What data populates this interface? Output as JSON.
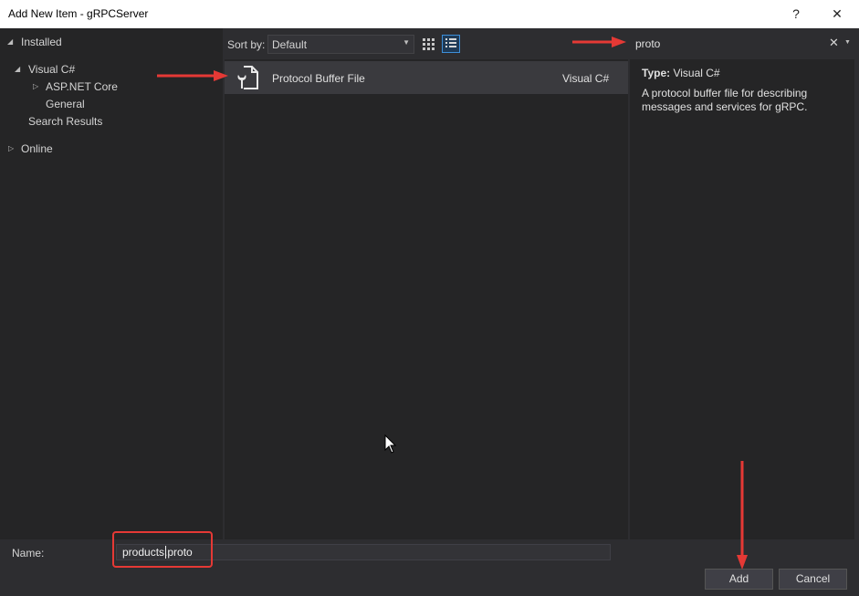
{
  "window": {
    "title": "Add New Item - gRPCServer",
    "help_glyph": "?",
    "close_glyph": "✕"
  },
  "tree": {
    "installed": "Installed",
    "visual_csharp": "Visual C#",
    "aspnet_core": "ASP.NET Core",
    "general": "General",
    "search_results": "Search Results",
    "online": "Online"
  },
  "toolbar": {
    "sort_label": "Sort by:",
    "sort_value": "Default",
    "view_icons": [
      "grid-view-icon",
      "list-view-icon"
    ]
  },
  "search": {
    "value": "proto",
    "clear_glyph": "✕"
  },
  "templates": [
    {
      "name": "Protocol Buffer File",
      "language": "Visual C#",
      "icon": "wrench-file-icon"
    }
  ],
  "details": {
    "type_label": "Type:",
    "type_value": "Visual C#",
    "description": "A protocol buffer file for describing messages and services for gRPC."
  },
  "name_field": {
    "label": "Name:",
    "value": "products.proto"
  },
  "buttons": {
    "add": "Add",
    "cancel": "Cancel"
  },
  "colors": {
    "accent_selection": "#3e8fd8",
    "annotation_red": "#e53935"
  }
}
